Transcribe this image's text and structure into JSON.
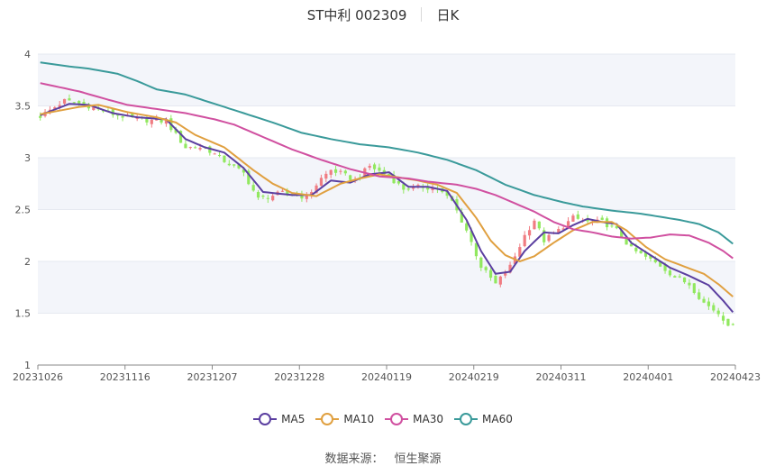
{
  "header": {
    "title": "ST中利 002309",
    "period": "日K"
  },
  "source": {
    "label": "数据来源：",
    "value": "恒生聚源"
  },
  "colors": {
    "up": "#f07c82",
    "down": "#91e85f",
    "grid": "#e6e9f0",
    "band": "#f3f5fa",
    "axis": "#888888"
  },
  "chart_data": {
    "type": "candlestick",
    "xlabel": "",
    "ylabel": "",
    "ylim": [
      1,
      4
    ],
    "y_ticks": [
      "1",
      "1.5",
      "2",
      "2.5",
      "3",
      "3.5",
      "4"
    ],
    "x_ticks": [
      "20231026",
      "20231116",
      "20231207",
      "20231228",
      "20240119",
      "20240219",
      "20240311",
      "20240401",
      "20240423"
    ],
    "legend": [
      {
        "name": "MA5",
        "color": "#5b3fa0"
      },
      {
        "name": "MA10",
        "color": "#e0a040"
      },
      {
        "name": "MA30",
        "color": "#d050a0"
      },
      {
        "name": "MA60",
        "color": "#3a9a9a"
      }
    ],
    "price_path": [
      [
        0,
        3.4
      ],
      [
        5,
        3.55
      ],
      [
        10,
        3.5
      ],
      [
        15,
        3.42
      ],
      [
        20,
        3.37
      ],
      [
        26,
        3.35
      ],
      [
        28,
        3.22
      ],
      [
        30,
        3.1
      ],
      [
        34,
        3.1
      ],
      [
        37,
        3.0
      ],
      [
        42,
        2.85
      ],
      [
        45,
        2.6
      ],
      [
        50,
        2.66
      ],
      [
        55,
        2.62
      ],
      [
        58,
        2.8
      ],
      [
        60,
        2.88
      ],
      [
        62,
        2.85
      ],
      [
        65,
        2.78
      ],
      [
        68,
        2.92
      ],
      [
        72,
        2.82
      ],
      [
        75,
        2.7
      ],
      [
        79,
        2.72
      ],
      [
        82,
        2.7
      ],
      [
        85,
        2.58
      ],
      [
        88,
        2.3
      ],
      [
        91,
        1.95
      ],
      [
        94,
        1.78
      ],
      [
        97,
        1.95
      ],
      [
        100,
        2.25
      ],
      [
        102,
        2.4
      ],
      [
        104,
        2.2
      ],
      [
        107,
        2.3
      ],
      [
        110,
        2.42
      ],
      [
        113,
        2.38
      ],
      [
        116,
        2.38
      ],
      [
        119,
        2.3
      ],
      [
        122,
        2.12
      ],
      [
        125,
        2.04
      ],
      [
        128,
        1.96
      ],
      [
        131,
        1.85
      ],
      [
        134,
        1.78
      ],
      [
        137,
        1.6
      ],
      [
        140,
        1.5
      ],
      [
        142,
        1.4
      ],
      [
        143,
        1.37
      ]
    ],
    "ma_paths": {
      "MA5": [
        [
          0,
          3.41
        ],
        [
          6,
          3.52
        ],
        [
          10,
          3.51
        ],
        [
          15,
          3.43
        ],
        [
          20,
          3.39
        ],
        [
          26,
          3.37
        ],
        [
          30,
          3.18
        ],
        [
          34,
          3.1
        ],
        [
          38,
          3.05
        ],
        [
          42,
          2.9
        ],
        [
          46,
          2.67
        ],
        [
          52,
          2.64
        ],
        [
          56,
          2.64
        ],
        [
          60,
          2.78
        ],
        [
          64,
          2.76
        ],
        [
          68,
          2.84
        ],
        [
          72,
          2.86
        ],
        [
          76,
          2.72
        ],
        [
          80,
          2.72
        ],
        [
          84,
          2.68
        ],
        [
          88,
          2.4
        ],
        [
          91,
          2.1
        ],
        [
          94,
          1.88
        ],
        [
          97,
          1.9
        ],
        [
          100,
          2.1
        ],
        [
          104,
          2.28
        ],
        [
          107,
          2.27
        ],
        [
          110,
          2.35
        ],
        [
          113,
          2.41
        ],
        [
          116,
          2.38
        ],
        [
          119,
          2.36
        ],
        [
          122,
          2.18
        ],
        [
          126,
          2.06
        ],
        [
          130,
          1.94
        ],
        [
          134,
          1.86
        ],
        [
          138,
          1.77
        ],
        [
          141,
          1.62
        ],
        [
          143,
          1.51
        ]
      ],
      "MA10": [
        [
          0,
          3.42
        ],
        [
          8,
          3.49
        ],
        [
          12,
          3.51
        ],
        [
          18,
          3.44
        ],
        [
          24,
          3.39
        ],
        [
          28,
          3.34
        ],
        [
          32,
          3.22
        ],
        [
          38,
          3.1
        ],
        [
          44,
          2.88
        ],
        [
          48,
          2.75
        ],
        [
          52,
          2.66
        ],
        [
          57,
          2.63
        ],
        [
          62,
          2.75
        ],
        [
          66,
          2.8
        ],
        [
          70,
          2.84
        ],
        [
          74,
          2.81
        ],
        [
          78,
          2.78
        ],
        [
          82,
          2.74
        ],
        [
          86,
          2.66
        ],
        [
          90,
          2.42
        ],
        [
          93,
          2.2
        ],
        [
          96,
          2.06
        ],
        [
          99,
          2.0
        ],
        [
          102,
          2.05
        ],
        [
          106,
          2.18
        ],
        [
          110,
          2.3
        ],
        [
          114,
          2.38
        ],
        [
          118,
          2.38
        ],
        [
          121,
          2.3
        ],
        [
          125,
          2.14
        ],
        [
          129,
          2.02
        ],
        [
          133,
          1.95
        ],
        [
          137,
          1.88
        ],
        [
          140,
          1.78
        ],
        [
          143,
          1.66
        ]
      ],
      "MA30": [
        [
          0,
          3.72
        ],
        [
          8,
          3.64
        ],
        [
          14,
          3.56
        ],
        [
          18,
          3.51
        ],
        [
          24,
          3.47
        ],
        [
          30,
          3.43
        ],
        [
          36,
          3.37
        ],
        [
          40,
          3.32
        ],
        [
          46,
          3.2
        ],
        [
          52,
          3.08
        ],
        [
          58,
          2.98
        ],
        [
          64,
          2.89
        ],
        [
          70,
          2.82
        ],
        [
          76,
          2.8
        ],
        [
          80,
          2.77
        ],
        [
          86,
          2.74
        ],
        [
          90,
          2.7
        ],
        [
          94,
          2.64
        ],
        [
          98,
          2.56
        ],
        [
          102,
          2.48
        ],
        [
          106,
          2.38
        ],
        [
          110,
          2.31
        ],
        [
          114,
          2.28
        ],
        [
          118,
          2.24
        ],
        [
          122,
          2.22
        ],
        [
          126,
          2.23
        ],
        [
          130,
          2.26
        ],
        [
          134,
          2.25
        ],
        [
          138,
          2.18
        ],
        [
          141,
          2.1
        ],
        [
          143,
          2.03
        ]
      ],
      "MA60": [
        [
          0,
          3.92
        ],
        [
          6,
          3.88
        ],
        [
          10,
          3.86
        ],
        [
          16,
          3.81
        ],
        [
          20,
          3.74
        ],
        [
          24,
          3.66
        ],
        [
          30,
          3.61
        ],
        [
          36,
          3.52
        ],
        [
          42,
          3.43
        ],
        [
          48,
          3.34
        ],
        [
          54,
          3.24
        ],
        [
          60,
          3.18
        ],
        [
          66,
          3.13
        ],
        [
          72,
          3.1
        ],
        [
          78,
          3.05
        ],
        [
          84,
          2.98
        ],
        [
          90,
          2.88
        ],
        [
          96,
          2.74
        ],
        [
          102,
          2.64
        ],
        [
          108,
          2.57
        ],
        [
          112,
          2.53
        ],
        [
          118,
          2.49
        ],
        [
          124,
          2.46
        ],
        [
          128,
          2.43
        ],
        [
          132,
          2.4
        ],
        [
          136,
          2.36
        ],
        [
          140,
          2.28
        ],
        [
          143,
          2.17
        ]
      ]
    }
  }
}
